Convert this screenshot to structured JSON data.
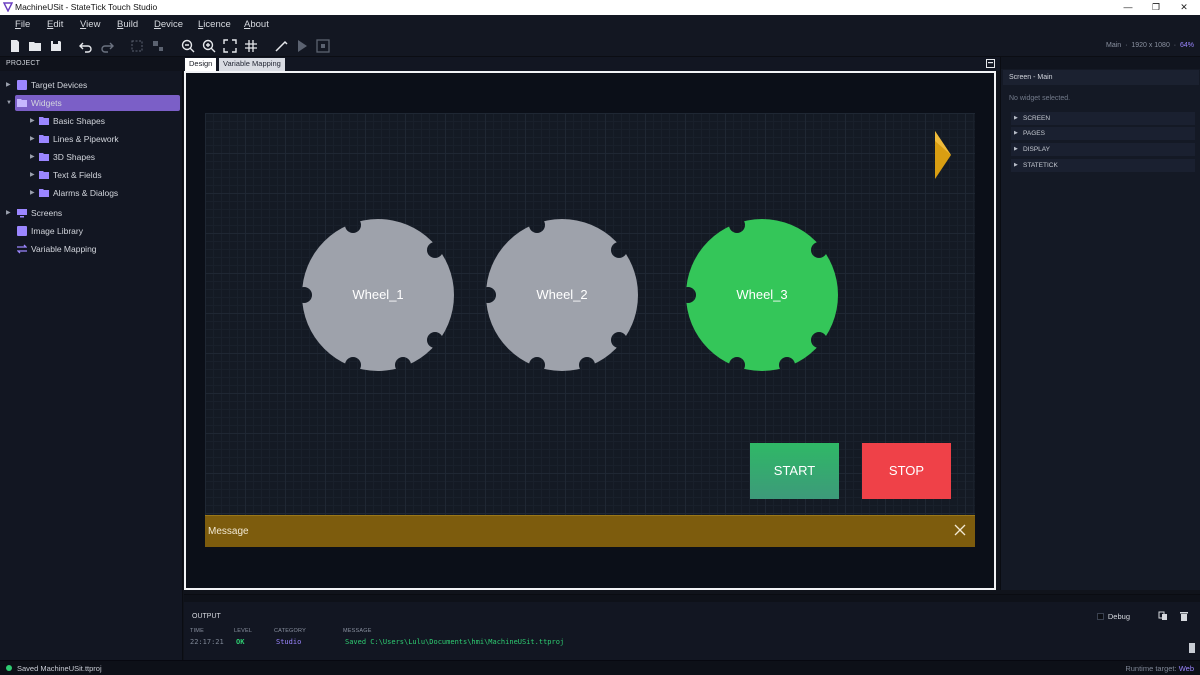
{
  "window": {
    "title": "MachineUSit - StateTick Touch Studio",
    "controls": [
      "—",
      "❐",
      "✕"
    ]
  },
  "menu": [
    {
      "accel": "F",
      "rest": "ile"
    },
    {
      "accel": "E",
      "rest": "dit"
    },
    {
      "accel": "V",
      "rest": "iew"
    },
    {
      "accel": "B",
      "rest": "uild"
    },
    {
      "accel": "D",
      "rest": "evice"
    },
    {
      "accel": "L",
      "rest": "icence"
    },
    {
      "accel": "A",
      "rest": "bout"
    }
  ],
  "toolbar": {
    "screen_name": "Main",
    "resolution": "1920 x 1080",
    "zoom": "64%"
  },
  "project": {
    "header": "PROJECT",
    "items": [
      {
        "label": "Target Devices",
        "icon": "device-icon"
      },
      {
        "label": "Widgets",
        "icon": "folder-icon"
      },
      {
        "label": "Basic Shapes",
        "icon": "folder-icon"
      },
      {
        "label": "Lines & Pipework",
        "icon": "folder-icon"
      },
      {
        "label": "3D Shapes",
        "icon": "folder-icon"
      },
      {
        "label": "Text & Fields",
        "icon": "folder-icon"
      },
      {
        "label": "Alarms & Dialogs",
        "icon": "folder-icon"
      },
      {
        "label": "Screens",
        "icon": "monitor-icon"
      },
      {
        "label": "Image Library",
        "icon": "image-icon"
      },
      {
        "label": "Variable Mapping",
        "icon": "swap-icon"
      }
    ]
  },
  "tabs": [
    {
      "label": "Design"
    },
    {
      "label": "Variable Mapping"
    }
  ],
  "canvas": {
    "wheels": [
      {
        "label": "Wheel_1",
        "color": "#9ea2ab"
      },
      {
        "label": "Wheel_2",
        "color": "#9ea2ab"
      },
      {
        "label": "Wheel_3",
        "color": "#34c659"
      }
    ],
    "start_label": "START",
    "stop_label": "STOP",
    "start_color": "#2fb866",
    "stop_color": "#ef4148",
    "message_label": "Message",
    "message_color": "#7d5c0d"
  },
  "properties": {
    "subheader": "Screen - Main",
    "empty_text": "No widget selected.",
    "sections": [
      "SCREEN",
      "PAGES",
      "DISPLAY",
      "STATETICK"
    ]
  },
  "output": {
    "title": "OUTPUT",
    "columns": [
      "TIME",
      "LEVEL",
      "CATEGORY",
      "MESSAGE"
    ],
    "rows": [
      {
        "time": "22:17:21",
        "level": "OK",
        "category": "Studio",
        "message": "Saved C:\\Users\\Lulu\\Documents\\hmi\\MachineUSit.ttproj"
      }
    ],
    "debug_label": "Debug"
  },
  "status": {
    "text": "Saved MachineUSit.ttproj",
    "runtime_label": "Runtime target:",
    "runtime_value": "Web"
  },
  "accent_color": "#7b5fc7"
}
